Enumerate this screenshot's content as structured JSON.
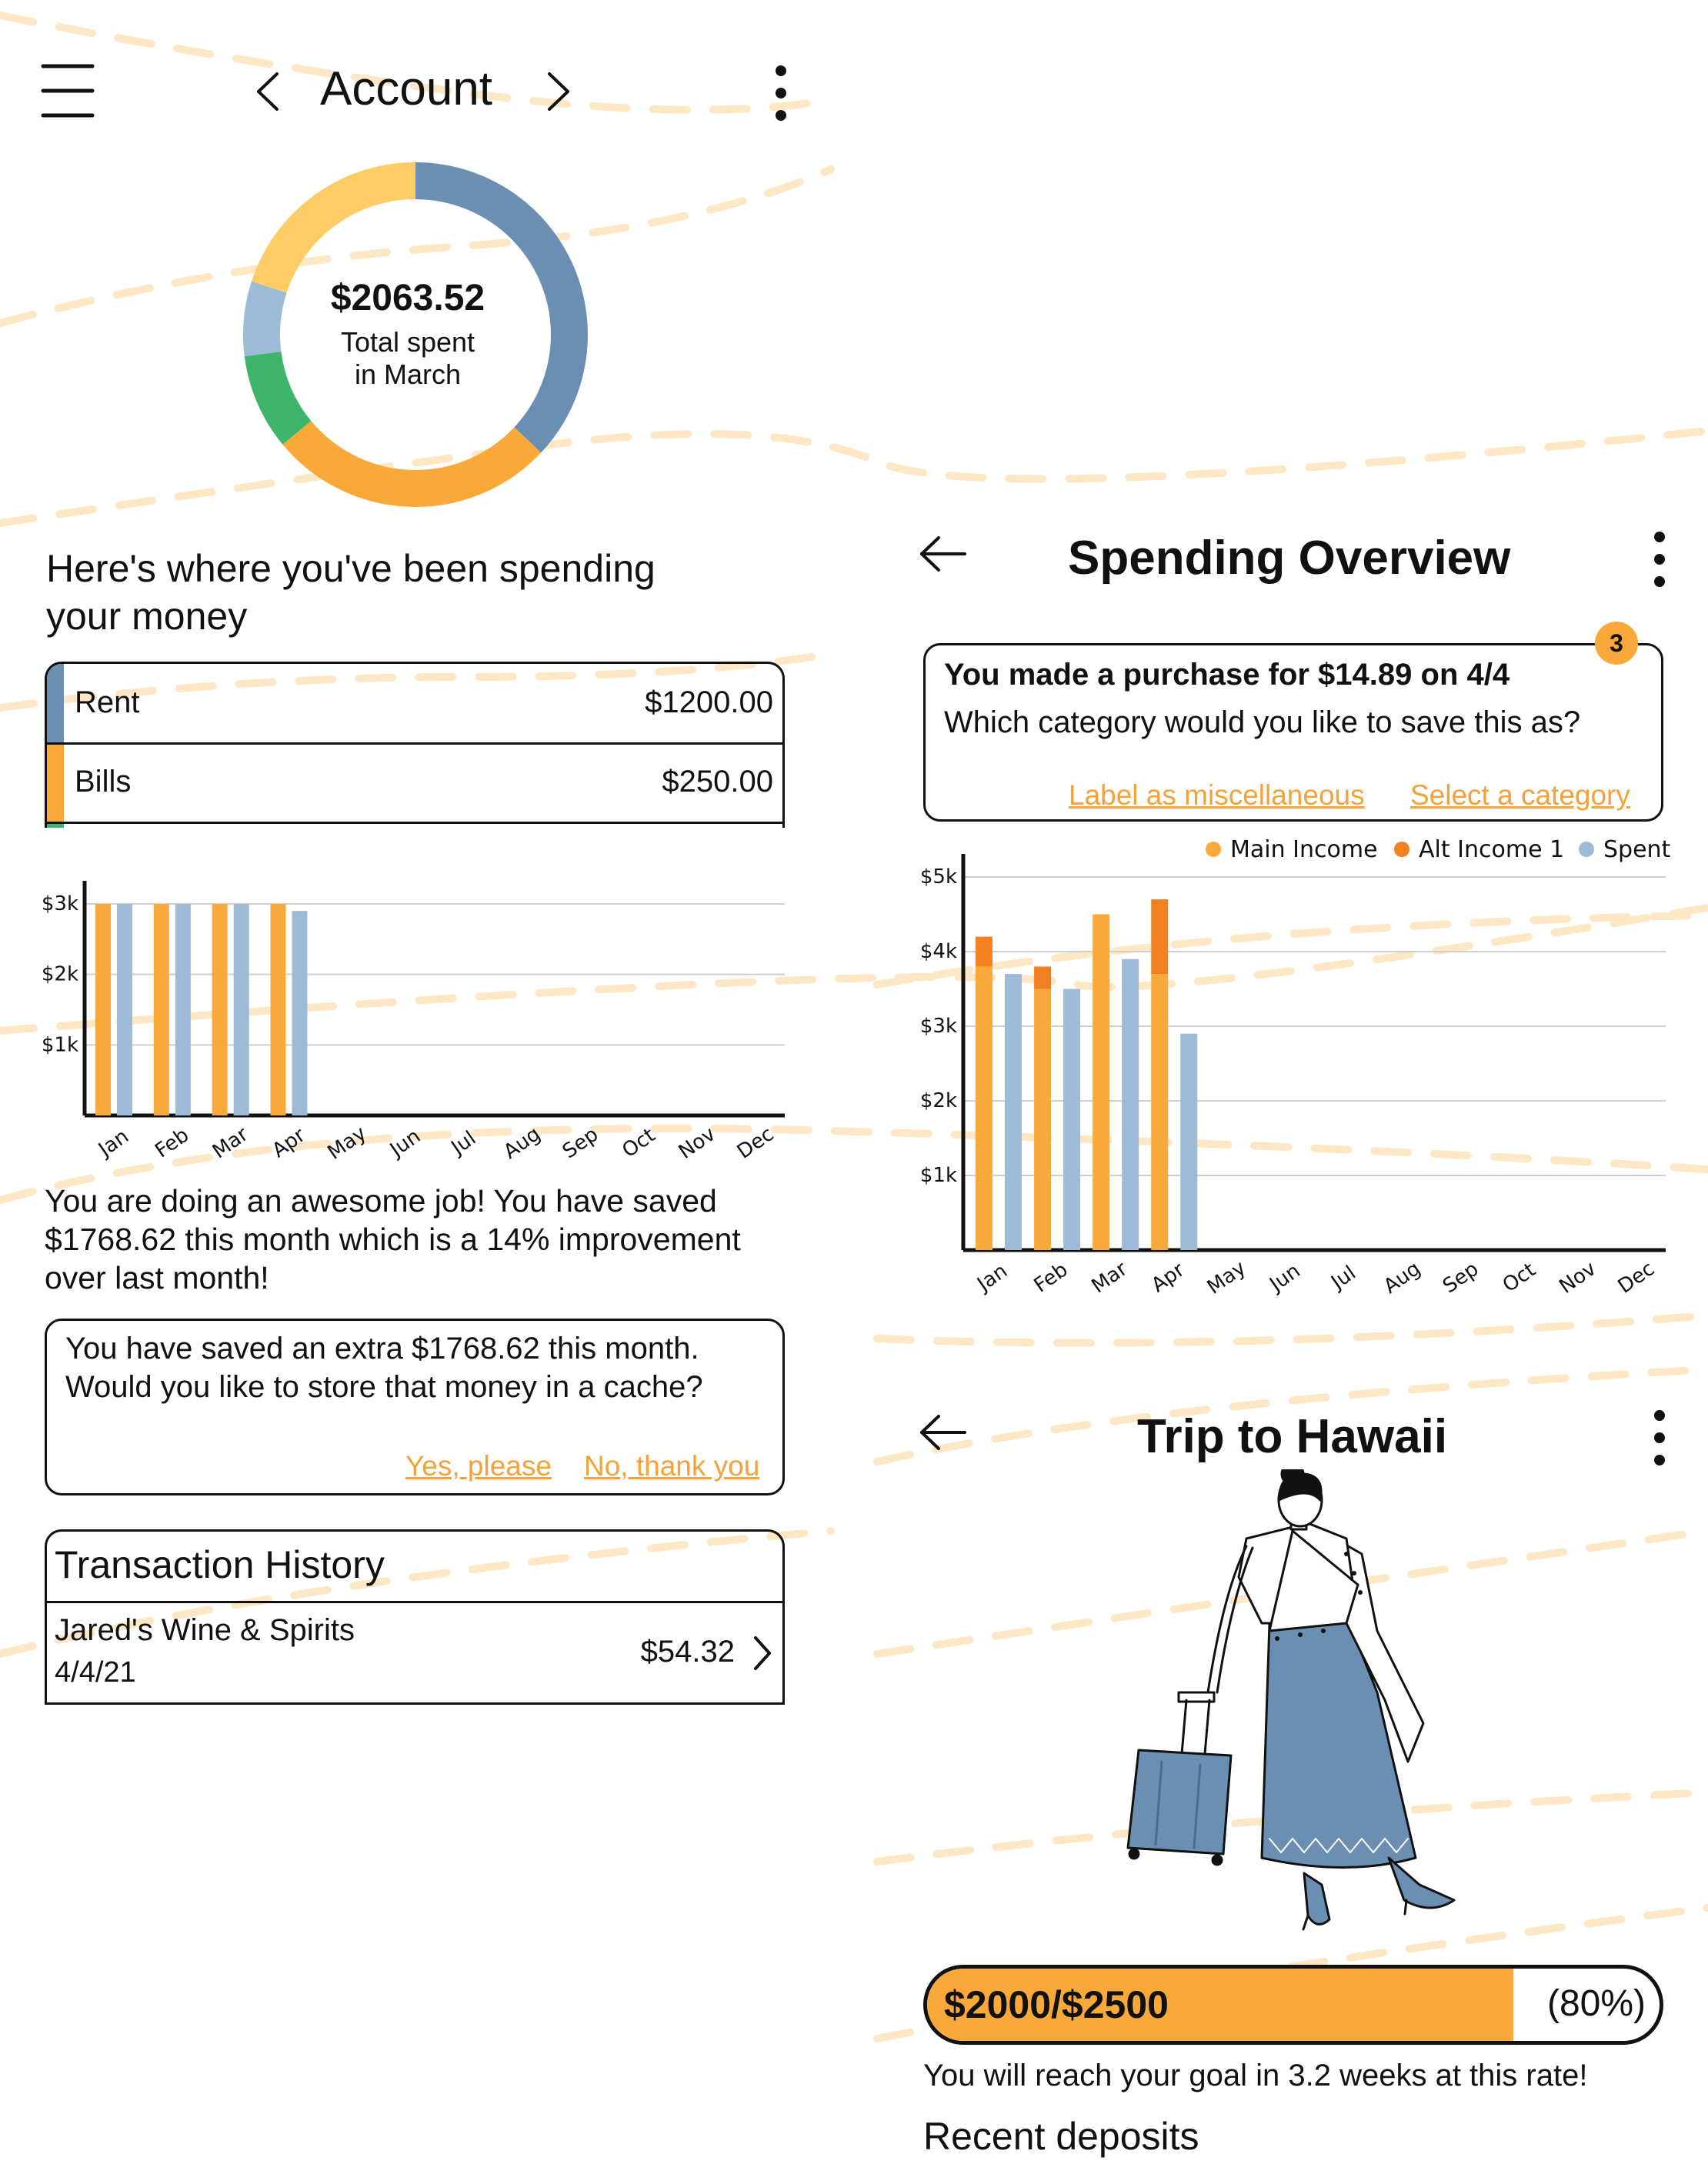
{
  "colors": {
    "accent_orange": "#f9a93a",
    "dark_orange": "#f27f20",
    "steel_blue": "#6b8fb3",
    "light_blue": "#9dbad6",
    "yellow": "#fdcc64",
    "green": "#3db56b",
    "background_dash": "#fde7c4"
  },
  "account": {
    "title": "Account",
    "menu_icon": "hamburger-menu-icon",
    "prev_icon": "chevron-left-icon",
    "next_icon": "chevron-right-icon",
    "more_icon": "more-vertical-icon",
    "donut": {
      "amount": "$2063.52",
      "caption_line1": "Total spent",
      "caption_line2": "in March"
    },
    "spending_heading_line1": "Here's where you've been spending",
    "spending_heading_line2": "your money",
    "categories": [
      {
        "label": "Rent",
        "amount": "$1200.00",
        "color": "#6b8fb3"
      },
      {
        "label": "Bills",
        "amount": "$250.00",
        "color": "#f9a93a"
      }
    ],
    "savings_message_line1": "You are doing an awesome job! You have saved",
    "savings_message_line2": "$1768.62 this month which is a 14% improvement",
    "savings_message_line3": "over last month!",
    "cache_prompt_line1": "You have saved an extra $1768.62 this month.",
    "cache_prompt_line2": "Would you like to store that money in a cache?",
    "cache_yes": "Yes, please",
    "cache_no": "No, thank you",
    "transactions": {
      "title": "Transaction History",
      "items": [
        {
          "merchant": "Jared's Wine & Spirits",
          "date": "4/4/21",
          "amount": "$54.32"
        }
      ]
    }
  },
  "overview": {
    "title": "Spending Overview",
    "back_icon": "arrow-left-icon",
    "more_icon": "more-vertical-icon",
    "notification": {
      "badge": "3",
      "line1": "You made a purchase for $14.89 on 4/4",
      "line2": "Which category would you like to save this as?",
      "link_misc": "Label as miscellaneous",
      "link_select": "Select a category"
    }
  },
  "hawaii": {
    "title": "Trip to Hawaii",
    "back_icon": "arrow-left-icon",
    "more_icon": "more-vertical-icon",
    "illustration": "traveler-with-suitcase-illustration",
    "progress_label": "$2000/$2500",
    "progress_percent_label": "(80%)",
    "progress_fraction": 0.8,
    "reach_goal": "You will reach your goal in 3.2 weeks at this rate!",
    "recent_deposits": "Recent deposits"
  },
  "chart_data": [
    {
      "type": "pie",
      "title": "",
      "variant": "donut",
      "slices": [
        {
          "color": "#6b8fb3",
          "value": 0.37
        },
        {
          "color": "#f9a93a",
          "value": 0.27
        },
        {
          "color": "#3db56b",
          "value": 0.09
        },
        {
          "color": "#9dbad6",
          "value": 0.07
        },
        {
          "color": "#fdcc64",
          "value": 0.2
        }
      ]
    },
    {
      "type": "bar",
      "categories": [
        "Jan",
        "Feb",
        "Mar",
        "Apr",
        "May",
        "Jun",
        "Jul",
        "Aug",
        "Sep",
        "Oct",
        "Nov",
        "Dec"
      ],
      "y_ticks": [
        "$1k",
        "$2k",
        "$3k"
      ],
      "ylim": [
        0,
        3000
      ],
      "grid": true,
      "series": [
        {
          "color": "#f9a93a",
          "values": [
            3000,
            3000,
            3000,
            3000,
            null,
            null,
            null,
            null,
            null,
            null,
            null,
            null
          ]
        },
        {
          "color": "#9dbad6",
          "values": [
            3000,
            3000,
            3000,
            2900,
            null,
            null,
            null,
            null,
            null,
            null,
            null,
            null
          ]
        }
      ]
    },
    {
      "type": "bar",
      "stacked_income": true,
      "categories": [
        "Jan",
        "Feb",
        "Mar",
        "Apr",
        "May",
        "Jun",
        "Jul",
        "Aug",
        "Sep",
        "Oct",
        "Nov",
        "Dec"
      ],
      "y_ticks": [
        "$1k",
        "$2k",
        "$3k",
        "$4k",
        "$5k"
      ],
      "ylim": [
        0,
        5000
      ],
      "grid": true,
      "legend_position": "top-right",
      "series": [
        {
          "name": "Main Income",
          "color": "#f9a93a",
          "values": [
            3800,
            3500,
            4500,
            3700,
            null,
            null,
            null,
            null,
            null,
            null,
            null,
            null
          ]
        },
        {
          "name": "Alt Income 1",
          "color": "#f27f20",
          "values": [
            400,
            300,
            0,
            1000,
            null,
            null,
            null,
            null,
            null,
            null,
            null,
            null
          ]
        },
        {
          "name": "Spent",
          "color": "#9dbad6",
          "values": [
            3700,
            3500,
            3900,
            2900,
            null,
            null,
            null,
            null,
            null,
            null,
            null,
            null
          ]
        }
      ]
    }
  ]
}
